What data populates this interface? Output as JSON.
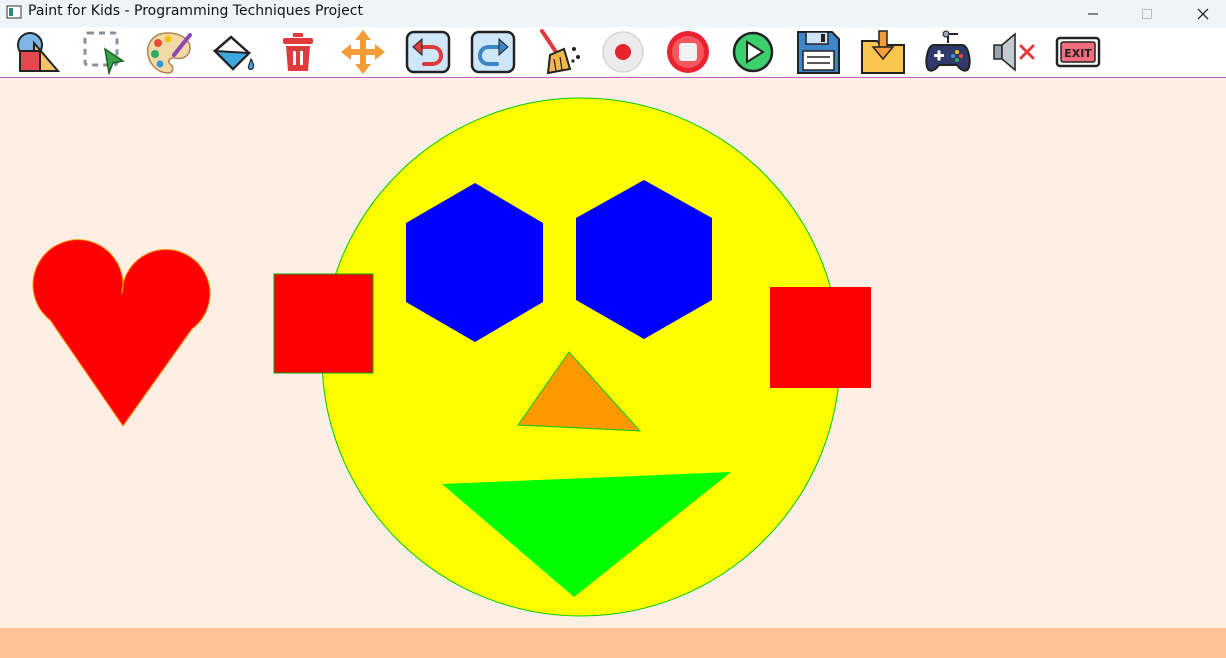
{
  "window": {
    "title": "Paint for Kids - Programming Techniques Project"
  },
  "toolbar": {
    "items": [
      {
        "id": "shapes",
        "icon": "shapes-icon"
      },
      {
        "id": "select",
        "icon": "select-icon"
      },
      {
        "id": "palette",
        "icon": "palette-icon"
      },
      {
        "id": "fill",
        "icon": "paint-bucket-icon"
      },
      {
        "id": "delete",
        "icon": "trash-icon"
      },
      {
        "id": "move",
        "icon": "move-arrows-icon"
      },
      {
        "id": "undo",
        "icon": "undo-icon"
      },
      {
        "id": "redo",
        "icon": "redo-icon"
      },
      {
        "id": "clear",
        "icon": "broom-icon"
      },
      {
        "id": "start-recording",
        "icon": "record-icon"
      },
      {
        "id": "stop-recording",
        "icon": "stop-icon"
      },
      {
        "id": "play-recording",
        "icon": "play-icon"
      },
      {
        "id": "save",
        "icon": "floppy-disk-icon"
      },
      {
        "id": "load",
        "icon": "folder-download-icon"
      },
      {
        "id": "play-mode",
        "icon": "gamepad-icon"
      },
      {
        "id": "mute",
        "icon": "speaker-mute-icon"
      },
      {
        "id": "exit",
        "icon": "exit-icon",
        "label": "EXIT"
      }
    ]
  },
  "canvas": {
    "background": "#ffeee3",
    "shapes": [
      {
        "type": "heart",
        "name": "heart-shape",
        "fill": "#ff0000",
        "border": "#ff9900"
      },
      {
        "type": "square",
        "name": "left-square",
        "fill": "#ff0000",
        "border": "#00aa00"
      },
      {
        "type": "circle",
        "name": "face-circle",
        "fill": "#ffff00",
        "border": "#00cc00"
      },
      {
        "type": "hexagon",
        "name": "left-eye-hexagon",
        "fill": "#0000ff",
        "border": "#0000ff"
      },
      {
        "type": "hexagon",
        "name": "right-eye-hexagon",
        "fill": "#0000ff",
        "border": "#0000ff"
      },
      {
        "type": "triangle",
        "name": "nose-triangle",
        "fill": "#ff9900",
        "border": "#00cc00"
      },
      {
        "type": "triangle",
        "name": "mouth-triangle",
        "fill": "#00ff00",
        "border": "#00cc00"
      },
      {
        "type": "square",
        "name": "right-square",
        "fill": "#ff0000",
        "border": "#ff0000"
      }
    ]
  },
  "statusbar": {
    "background": "#fcc495",
    "message": ""
  }
}
